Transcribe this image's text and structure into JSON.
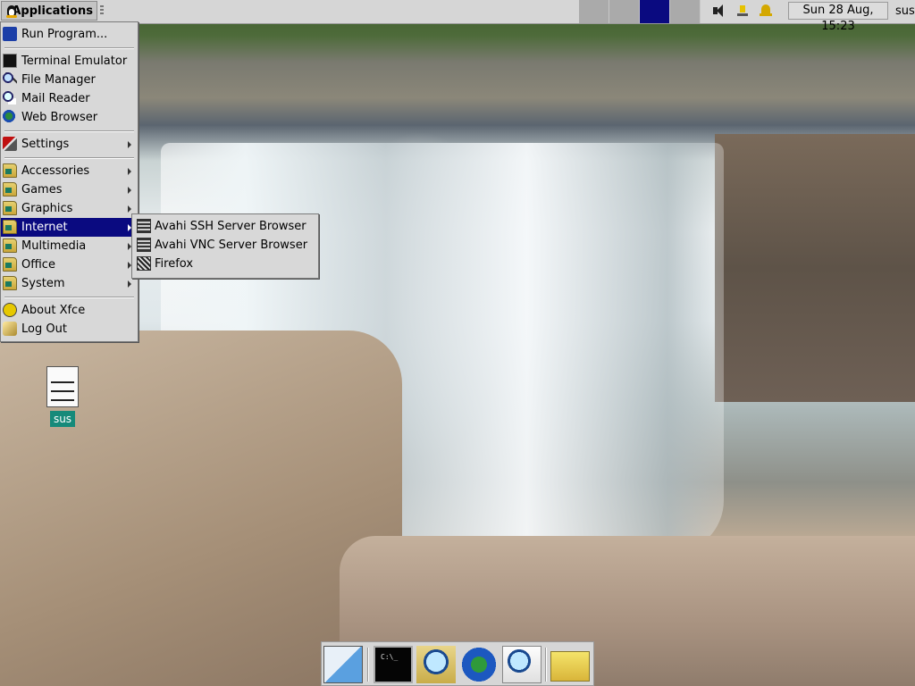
{
  "top_panel": {
    "applications_label": "Applications",
    "clock": "Sun 28 Aug, 15:23",
    "user": "sus",
    "workspaces": 4,
    "active_workspace": 3,
    "tray_icons": [
      "speaker-icon",
      "network-icon",
      "bell-icon"
    ]
  },
  "main_menu": {
    "items": [
      {
        "label": "Run Program...",
        "icon": "run-icon"
      },
      {
        "label": "Terminal Emulator",
        "icon": "terminal-icon"
      },
      {
        "label": "File Manager",
        "icon": "file-manager-icon"
      },
      {
        "label": "Mail Reader",
        "icon": "mail-icon"
      },
      {
        "label": "Web Browser",
        "icon": "globe-icon"
      },
      {
        "label": "Settings",
        "icon": "settings-icon",
        "submenu": true
      },
      {
        "label": "Accessories",
        "icon": "folder-icon",
        "submenu": true
      },
      {
        "label": "Games",
        "icon": "folder-icon",
        "submenu": true
      },
      {
        "label": "Graphics",
        "icon": "folder-icon",
        "submenu": true
      },
      {
        "label": "Internet",
        "icon": "folder-icon",
        "submenu": true,
        "selected": true
      },
      {
        "label": "Multimedia",
        "icon": "folder-icon",
        "submenu": true
      },
      {
        "label": "Office",
        "icon": "folder-icon",
        "submenu": true
      },
      {
        "label": "System",
        "icon": "folder-icon",
        "submenu": true
      },
      {
        "label": "About Xfce",
        "icon": "smiley-icon"
      },
      {
        "label": "Log Out",
        "icon": "logout-icon"
      }
    ]
  },
  "internet_submenu": {
    "items": [
      {
        "label": "Avahi SSH Server Browser",
        "icon": "network-browser-icon"
      },
      {
        "label": "Avahi VNC Server Browser",
        "icon": "network-browser-icon"
      },
      {
        "label": "Firefox",
        "icon": "firefox-icon"
      }
    ]
  },
  "desktop": {
    "icons": [
      {
        "label": "sus",
        "icon": "notepad-icon"
      }
    ]
  },
  "launcher": {
    "items": [
      "text-editor-icon",
      "terminal-icon",
      "file-search-icon",
      "web-browser-icon",
      "find-icon",
      "folder-icon"
    ]
  }
}
